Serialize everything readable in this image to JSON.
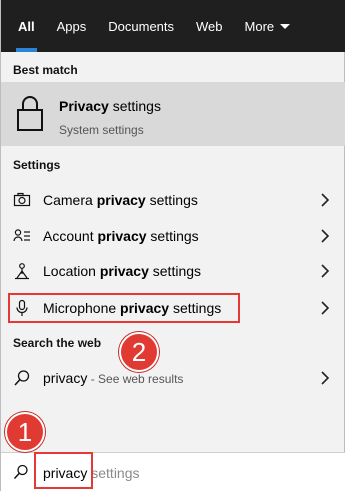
{
  "tabs": [
    {
      "label": "All",
      "active": true
    },
    {
      "label": "Apps"
    },
    {
      "label": "Documents"
    },
    {
      "label": "Web"
    },
    {
      "label": "More"
    }
  ],
  "best_match": {
    "heading": "Best match",
    "title_bold": "Privacy",
    "title_rest": " settings",
    "subtitle": "System settings",
    "icon": "lock-icon"
  },
  "settings": {
    "heading": "Settings",
    "items": [
      {
        "pre": "Camera ",
        "bold": "privacy",
        "post": " settings",
        "icon": "camera-icon"
      },
      {
        "pre": "Account ",
        "bold": "privacy",
        "post": " settings",
        "icon": "account-icon"
      },
      {
        "pre": "Location ",
        "bold": "privacy",
        "post": " settings",
        "icon": "location-icon"
      },
      {
        "pre": "Microphone ",
        "bold": "privacy",
        "post": " settings",
        "icon": "microphone-icon"
      }
    ]
  },
  "web": {
    "heading": "Search the web",
    "query": "privacy",
    "suffix": " - See web results",
    "icon": "search-icon"
  },
  "search": {
    "typed": "privacy",
    "suggestion": " settings"
  },
  "annotations": {
    "step1": "1",
    "step2": "2",
    "highlight_color": "#e53935"
  },
  "colors": {
    "tab_bar": "#1f1f1f",
    "accent": "#2c84d6",
    "best_match_bg": "#d9d9d9",
    "panel_bg": "#f2f2f2"
  }
}
